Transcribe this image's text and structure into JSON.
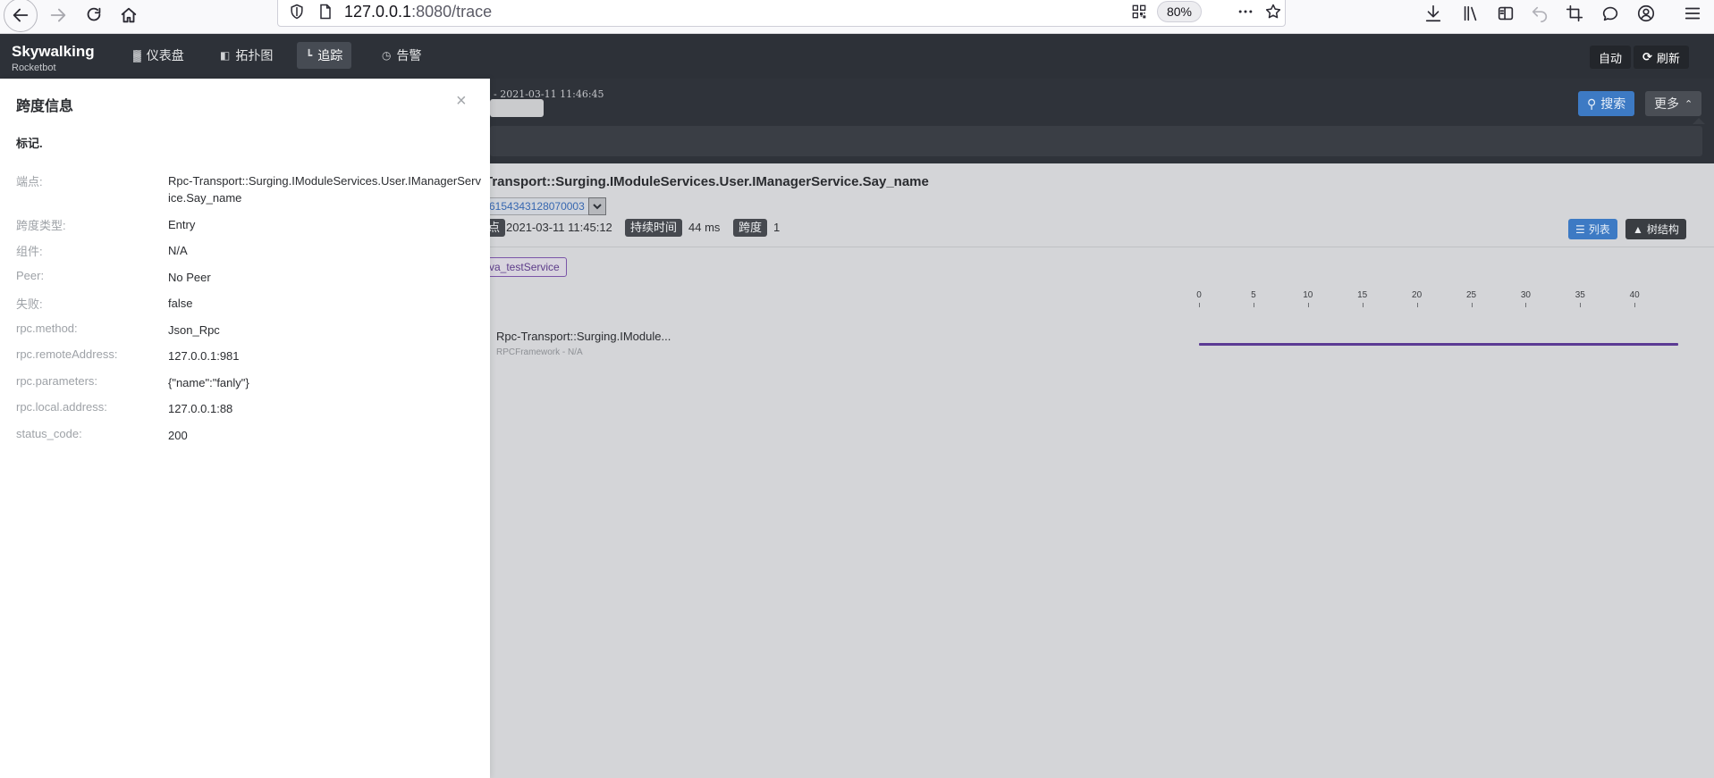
{
  "browser": {
    "url_host": "127.0.0.1",
    "url_path": ":8080/trace",
    "zoom": "80%"
  },
  "header": {
    "logo_main": "Skywalking",
    "logo_sub": "Rocketbot",
    "nav": [
      {
        "label": "仪表盘",
        "icon": "dashboard-icon"
      },
      {
        "label": "拓扑图",
        "icon": "topology-icon"
      },
      {
        "label": "追踪",
        "icon": "trace-icon",
        "active": true
      },
      {
        "label": "告警",
        "icon": "alarm-icon"
      }
    ],
    "auto_label": "自动",
    "refresh_label": "刷新"
  },
  "search": {
    "time_range": "- 2021-03-11 11:46:45",
    "search_label": "搜索",
    "more_label": "更多"
  },
  "trace": {
    "title": "Transport::Surging.IModuleServices.User.IManagerService.Say_name",
    "trace_id": "6154343128070003",
    "start_badge": "点",
    "start_time": "2021-03-11 11:45:12",
    "duration_badge": "持续时间",
    "duration": "44 ms",
    "span_badge": "跨度",
    "span_count": "1",
    "view_list_label": "列表",
    "view_tree_label": "树结构",
    "service_tag": "va_testService"
  },
  "timeline": {
    "ticks": [
      "0",
      "5",
      "10",
      "15",
      "20",
      "25",
      "30",
      "35",
      "40"
    ],
    "max_ms": 44,
    "span": {
      "name": "Rpc-Transport::Surging.IModule...",
      "subtitle": "RPCFramework - N/A",
      "start_ms": 0,
      "duration_ms": 44
    }
  },
  "drawer": {
    "title": "跨度信息",
    "close": "×",
    "section": "标记.",
    "rows": [
      {
        "key": "端点:",
        "value": "Rpc-Transport::Surging.IModuleServices.User.IManagerService.Say_name"
      },
      {
        "key": "跨度类型:",
        "value": "Entry"
      },
      {
        "key": "组件:",
        "value": "N/A"
      },
      {
        "key": "Peer:",
        "value": "No Peer"
      },
      {
        "key": "失败:",
        "value": "false"
      },
      {
        "key": "rpc.method:",
        "value": "Json_Rpc"
      },
      {
        "key": "rpc.remoteAddress:",
        "value": "127.0.0.1:981"
      },
      {
        "key": "rpc.parameters:",
        "value": "{\"name\":\"fanly\"}"
      },
      {
        "key": "rpc.local.address:",
        "value": "127.0.0.1:88"
      },
      {
        "key": "status_code:",
        "value": "200"
      }
    ]
  },
  "colors": {
    "header_bg": "#2d3138",
    "accent_blue": "#3d7ac4",
    "span_bar": "#5b3a94"
  }
}
